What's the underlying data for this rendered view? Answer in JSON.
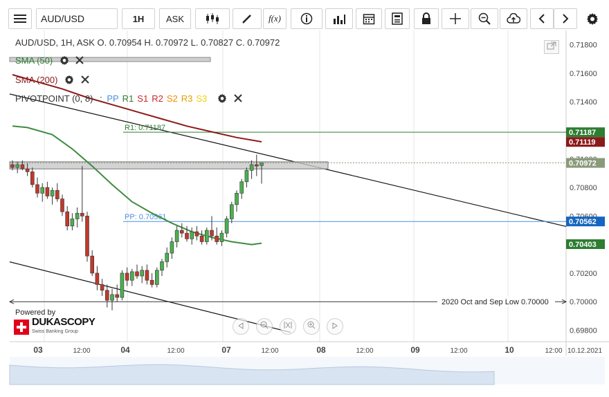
{
  "toolbar": {
    "symbol": "AUD/USD",
    "timeframe": "1H",
    "price_type": "ASK",
    "function_label": "f(x)"
  },
  "legend": {
    "ohlc": "AUD/USD, 1H, ASK   O. 0.70954 H. 0.70972 L. 0.70827 C. 0.70972",
    "sma50": "SMA (50)",
    "sma200": "SMA (200)",
    "pivot": "PIVOTPOINT (0, 8)",
    "pivot_sep": ":",
    "pivot_items": [
      {
        "label": "PP",
        "color": "#4a90e2"
      },
      {
        "label": "R1",
        "color": "#2e7d32"
      },
      {
        "label": "S1",
        "color": "#c62828"
      },
      {
        "label": "R2",
        "color": "#c62828"
      },
      {
        "label": "S2",
        "color": "#ef8c00"
      },
      {
        "label": "R3",
        "color": "#e0a000"
      },
      {
        "label": "S3",
        "color": "#f5d000"
      }
    ]
  },
  "powered_by": "Powered by",
  "logo": {
    "name": "DUKASCOPY",
    "tagline": "Swiss Banking Group"
  },
  "chart_data": {
    "type": "candlestick",
    "ylim": [
      0.6972,
      0.719
    ],
    "y_ticks": [
      "0.71800",
      "0.71600",
      "0.71400",
      "0.71200",
      "0.71000",
      "0.70800",
      "0.70600",
      "0.70400",
      "0.70200",
      "0.70000",
      "0.69800"
    ],
    "x_ticks": [
      "03",
      "12:00",
      "04",
      "12:00",
      "07",
      "12:00",
      "08",
      "12:00",
      "09",
      "12:00",
      "10",
      "12:00",
      "10.12.2021"
    ],
    "candles": [
      {
        "o": 0.7096,
        "h": 0.7099,
        "l": 0.7092,
        "c": 0.7094
      },
      {
        "o": 0.7094,
        "h": 0.7098,
        "l": 0.709,
        "c": 0.7096
      },
      {
        "o": 0.7096,
        "h": 0.7099,
        "l": 0.7092,
        "c": 0.7093
      },
      {
        "o": 0.7093,
        "h": 0.7097,
        "l": 0.7088,
        "c": 0.7091
      },
      {
        "o": 0.7091,
        "h": 0.7094,
        "l": 0.708,
        "c": 0.7082
      },
      {
        "o": 0.7082,
        "h": 0.7087,
        "l": 0.7073,
        "c": 0.7076
      },
      {
        "o": 0.7076,
        "h": 0.7083,
        "l": 0.707,
        "c": 0.708
      },
      {
        "o": 0.708,
        "h": 0.7084,
        "l": 0.7072,
        "c": 0.7074
      },
      {
        "o": 0.7074,
        "h": 0.708,
        "l": 0.7068,
        "c": 0.7078
      },
      {
        "o": 0.7078,
        "h": 0.7083,
        "l": 0.707,
        "c": 0.7072
      },
      {
        "o": 0.7072,
        "h": 0.7075,
        "l": 0.706,
        "c": 0.7063
      },
      {
        "o": 0.7063,
        "h": 0.7067,
        "l": 0.705,
        "c": 0.7053
      },
      {
        "o": 0.7053,
        "h": 0.7062,
        "l": 0.705,
        "c": 0.7058
      },
      {
        "o": 0.7058,
        "h": 0.7066,
        "l": 0.7052,
        "c": 0.7062
      },
      {
        "o": 0.7062,
        "h": 0.7095,
        "l": 0.7056,
        "c": 0.706
      },
      {
        "o": 0.706,
        "h": 0.7063,
        "l": 0.7028,
        "c": 0.7032
      },
      {
        "o": 0.7032,
        "h": 0.7036,
        "l": 0.7018,
        "c": 0.702
      },
      {
        "o": 0.702,
        "h": 0.7025,
        "l": 0.7008,
        "c": 0.7012
      },
      {
        "o": 0.7012,
        "h": 0.7016,
        "l": 0.7004,
        "c": 0.7008
      },
      {
        "o": 0.7008,
        "h": 0.7012,
        "l": 0.6996,
        "c": 0.7001
      },
      {
        "o": 0.7001,
        "h": 0.7009,
        "l": 0.6994,
        "c": 0.7005
      },
      {
        "o": 0.7005,
        "h": 0.7012,
        "l": 0.7,
        "c": 0.7003
      },
      {
        "o": 0.7003,
        "h": 0.7022,
        "l": 0.7001,
        "c": 0.702
      },
      {
        "o": 0.702,
        "h": 0.7024,
        "l": 0.7011,
        "c": 0.7015
      },
      {
        "o": 0.7015,
        "h": 0.7023,
        "l": 0.7011,
        "c": 0.7021
      },
      {
        "o": 0.7021,
        "h": 0.7026,
        "l": 0.7016,
        "c": 0.7018
      },
      {
        "o": 0.7018,
        "h": 0.7025,
        "l": 0.7013,
        "c": 0.7022
      },
      {
        "o": 0.7022,
        "h": 0.7026,
        "l": 0.7012,
        "c": 0.7015
      },
      {
        "o": 0.7015,
        "h": 0.702,
        "l": 0.701,
        "c": 0.7012
      },
      {
        "o": 0.7012,
        "h": 0.7024,
        "l": 0.701,
        "c": 0.7022
      },
      {
        "o": 0.7022,
        "h": 0.703,
        "l": 0.7018,
        "c": 0.7028
      },
      {
        "o": 0.7028,
        "h": 0.7038,
        "l": 0.7024,
        "c": 0.7034
      },
      {
        "o": 0.7034,
        "h": 0.7045,
        "l": 0.703,
        "c": 0.7042
      },
      {
        "o": 0.7042,
        "h": 0.7053,
        "l": 0.7038,
        "c": 0.705
      },
      {
        "o": 0.705,
        "h": 0.7055,
        "l": 0.7045,
        "c": 0.7048
      },
      {
        "o": 0.7048,
        "h": 0.7053,
        "l": 0.7042,
        "c": 0.7044
      },
      {
        "o": 0.7044,
        "h": 0.7052,
        "l": 0.704,
        "c": 0.7049
      },
      {
        "o": 0.7049,
        "h": 0.7053,
        "l": 0.7043,
        "c": 0.7046
      },
      {
        "o": 0.7046,
        "h": 0.705,
        "l": 0.704,
        "c": 0.7042
      },
      {
        "o": 0.7042,
        "h": 0.7052,
        "l": 0.704,
        "c": 0.705
      },
      {
        "o": 0.705,
        "h": 0.706,
        "l": 0.7043,
        "c": 0.7046
      },
      {
        "o": 0.7046,
        "h": 0.7052,
        "l": 0.704,
        "c": 0.7042
      },
      {
        "o": 0.7042,
        "h": 0.705,
        "l": 0.7039,
        "c": 0.7048
      },
      {
        "o": 0.7048,
        "h": 0.706,
        "l": 0.7045,
        "c": 0.7058
      },
      {
        "o": 0.7058,
        "h": 0.707,
        "l": 0.7055,
        "c": 0.7068
      },
      {
        "o": 0.7068,
        "h": 0.7078,
        "l": 0.7063,
        "c": 0.7076
      },
      {
        "o": 0.7076,
        "h": 0.7086,
        "l": 0.7072,
        "c": 0.7084
      },
      {
        "o": 0.7084,
        "h": 0.7094,
        "l": 0.708,
        "c": 0.7092
      },
      {
        "o": 0.7092,
        "h": 0.7099,
        "l": 0.7086,
        "c": 0.7096
      },
      {
        "o": 0.7096,
        "h": 0.7103,
        "l": 0.7088,
        "c": 0.7095
      },
      {
        "o": 0.70954,
        "h": 0.70972,
        "l": 0.70827,
        "c": 0.70972
      }
    ],
    "sma50": [
      [
        0,
        0.7123
      ],
      [
        3,
        0.7122
      ],
      [
        8,
        0.7117
      ],
      [
        12,
        0.7107
      ],
      [
        16,
        0.7095
      ],
      [
        20,
        0.7082
      ],
      [
        24,
        0.707
      ],
      [
        28,
        0.7062
      ],
      [
        32,
        0.7055
      ],
      [
        36,
        0.7049
      ],
      [
        40,
        0.7045
      ],
      [
        44,
        0.7042
      ],
      [
        48,
        0.704
      ],
      [
        50,
        0.7041
      ]
    ],
    "sma200": [
      [
        0,
        0.7159
      ],
      [
        5,
        0.7154
      ],
      [
        10,
        0.7149
      ],
      [
        15,
        0.7143
      ],
      [
        20,
        0.7138
      ],
      [
        25,
        0.7133
      ],
      [
        30,
        0.7128
      ],
      [
        35,
        0.7123
      ],
      [
        40,
        0.7119
      ],
      [
        45,
        0.7115
      ],
      [
        50,
        0.7112
      ]
    ],
    "resistance_zone": [
      0.7093,
      0.7098
    ],
    "levels": [
      {
        "name": "R1",
        "label": "R1: 0.71187",
        "value": 0.71187,
        "axis_label": "0.71187",
        "color": "#2e7d32"
      },
      {
        "name": "PP",
        "label": "PP: 0.70561",
        "value": 0.70562,
        "axis_label": "0.70562",
        "color": "#4a90e2"
      },
      {
        "name": "S",
        "label": "2020 Oct and Sep Low  0.70000",
        "value": 0.7,
        "axis_label": "",
        "color": "#333333"
      }
    ],
    "axis_markers": [
      {
        "value": 0.71187,
        "text": "0.71187",
        "color": "#2e7d32"
      },
      {
        "value": 0.71119,
        "text": "0.71119",
        "color": "#8b1a1a"
      },
      {
        "value": 0.70972,
        "text": "0.70972",
        "color": "#8a9a7a"
      },
      {
        "value": 0.70562,
        "text": "0.70562",
        "color": "#1565c0"
      },
      {
        "value": 0.70403,
        "text": "0.70403",
        "color": "#2e7d32"
      }
    ]
  }
}
